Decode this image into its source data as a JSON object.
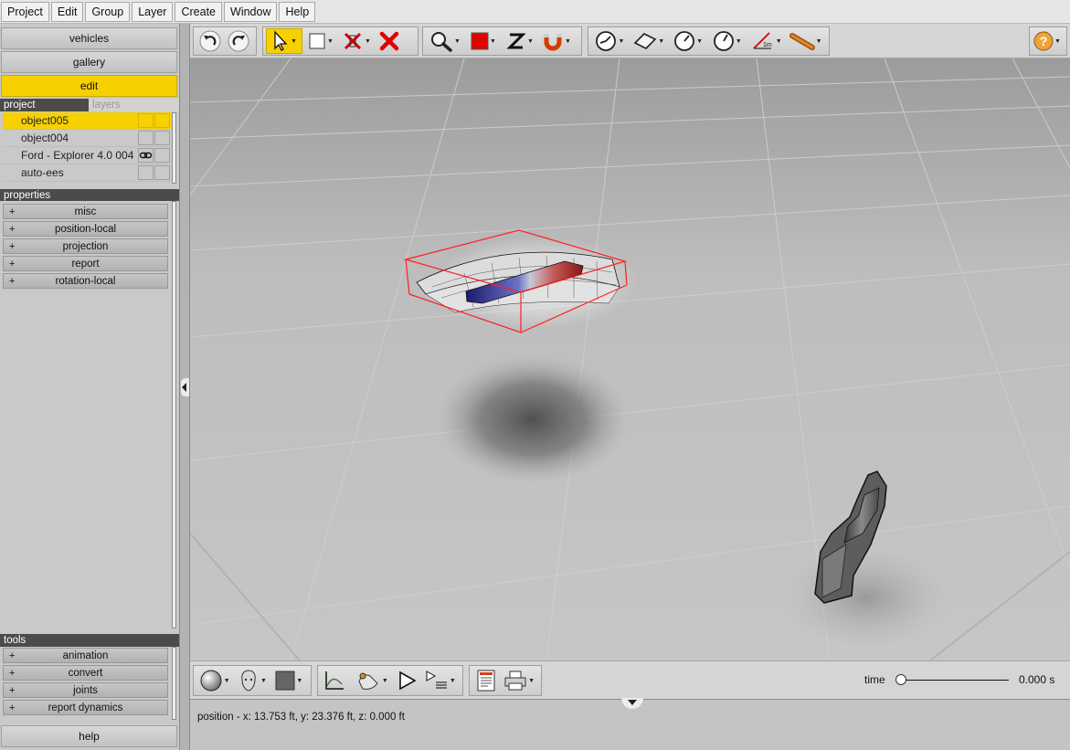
{
  "menu": [
    "Project",
    "Edit",
    "Group",
    "Layer",
    "Create",
    "Window",
    "Help"
  ],
  "nav": {
    "vehicles": "vehicles",
    "gallery": "gallery",
    "edit": "edit"
  },
  "project_tabs": {
    "project": "project",
    "layers": "layers"
  },
  "objects": [
    {
      "name": "object005",
      "selected": true
    },
    {
      "name": "object004",
      "selected": false
    },
    {
      "name": "Ford - Explorer 4.0 004",
      "selected": false,
      "icon": "link-icon"
    },
    {
      "name": "auto-ees",
      "selected": false
    }
  ],
  "properties_header": "properties",
  "properties": [
    "misc",
    "position-local",
    "projection",
    "report",
    "rotation-local"
  ],
  "tools_header": "tools",
  "tools": [
    "animation",
    "convert",
    "joints",
    "report dynamics"
  ],
  "help_label": "help",
  "toolbar_icons": [
    "undo-icon",
    "redo-icon",
    "select-arrow-icon",
    "box-select-icon",
    "hide-icon",
    "delete-icon",
    "zoom-icon",
    "color-icon",
    "z-axis-icon",
    "snap-magnet-icon",
    "measure-angle-icon",
    "plane-icon",
    "gauge-icon",
    "gauge-2-icon",
    "ruler-1m-icon",
    "tape-measure-icon",
    "help-icon"
  ],
  "bottom_icons": [
    "sphere-render-icon",
    "head-icon",
    "gray-square-icon",
    "graph-icon",
    "camera-icon",
    "play-icon",
    "playlist-icon",
    "report-icon",
    "print-icon"
  ],
  "time": {
    "label": "time",
    "value": "0.000 s",
    "progress": 0
  },
  "status": "position - x: 13.753 ft, y: 23.376 ft, z: 0.000 ft",
  "colors": {
    "accent": "#f7d000",
    "selection_box": "#ff2020",
    "panel": "#c9c9c9",
    "header": "#4b4b4b"
  }
}
